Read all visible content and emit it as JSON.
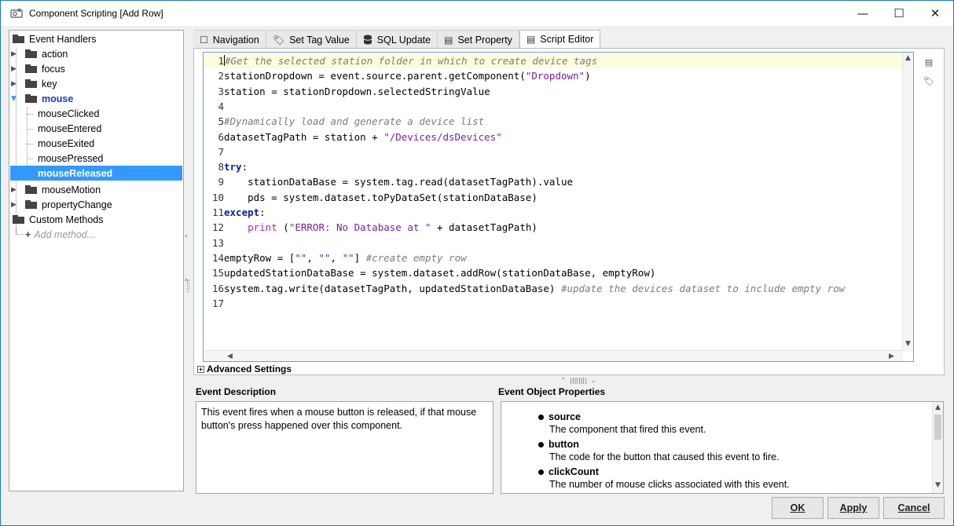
{
  "window": {
    "title": "Component Scripting [Add Row]",
    "controls": [
      "—",
      "☐",
      "✕"
    ]
  },
  "tree": {
    "root_label": "Event Handlers",
    "groups": [
      {
        "label": "action",
        "expanded": false
      },
      {
        "label": "focus",
        "expanded": false
      },
      {
        "label": "key",
        "expanded": false
      },
      {
        "label": "mouse",
        "expanded": true,
        "children": [
          "mouseClicked",
          "mouseEntered",
          "mouseExited",
          "mousePressed",
          "mouseReleased"
        ]
      },
      {
        "label": "mouseMotion",
        "expanded": false
      },
      {
        "label": "propertyChange",
        "expanded": false
      }
    ],
    "selected": "mouseReleased",
    "custom_methods_label": "Custom Methods",
    "add_method_label": "Add method..."
  },
  "tabs": [
    {
      "label": "Navigation",
      "icon": "navigation-icon"
    },
    {
      "label": "Set Tag Value",
      "icon": "tag-icon"
    },
    {
      "label": "SQL Update",
      "icon": "database-icon"
    },
    {
      "label": "Set Property",
      "icon": "property-icon"
    },
    {
      "label": "Script Editor",
      "icon": "script-icon",
      "active": true
    }
  ],
  "editor": {
    "lines": [
      {
        "n": "1",
        "text": "#Get the selected station folder in which to create device tags"
      },
      {
        "n": "2",
        "text": "stationDropdown = event.source.parent.getComponent(\"Dropdown\")"
      },
      {
        "n": "3",
        "text": "station = stationDropdown.selectedStringValue"
      },
      {
        "n": "4",
        "text": ""
      },
      {
        "n": "5",
        "text": "#Dynamically load and generate a device list"
      },
      {
        "n": "6",
        "text": "datasetTagPath = station + \"/Devices/dsDevices\""
      },
      {
        "n": "7",
        "text": ""
      },
      {
        "n": "8",
        "text": "try:"
      },
      {
        "n": "9",
        "text": "    stationDataBase = system.tag.read(datasetTagPath).value"
      },
      {
        "n": "10",
        "text": "    pds = system.dataset.toPyDataSet(stationDataBase)"
      },
      {
        "n": "11",
        "text": "except:"
      },
      {
        "n": "12",
        "text": "    print (\"ERROR: No Database at \" + datasetTagPath)"
      },
      {
        "n": "13",
        "text": ""
      },
      {
        "n": "14",
        "text": "emptyRow = [\"\", \"\", \"\"] #create empty row"
      },
      {
        "n": "15",
        "text": "updatedStationDataBase = system.dataset.addRow(stationDataBase, emptyRow)"
      },
      {
        "n": "16",
        "text": "system.tag.write(datasetTagPath, updatedStationDataBase) #update the devices dataset to include empty row"
      },
      {
        "n": "17",
        "text": ""
      }
    ]
  },
  "advanced_settings_label": "Advanced Settings",
  "event_description": {
    "label": "Event Description",
    "text": "This event fires when a mouse button is released, if that mouse button's press happened over this component."
  },
  "event_object_properties": {
    "label": "Event Object Properties",
    "items": [
      {
        "name": "source",
        "desc": "The component that fired this event."
      },
      {
        "name": "button",
        "desc": "The code for the button that caused this event to fire."
      },
      {
        "name": "clickCount",
        "desc": "The number of mouse clicks associated with this event."
      }
    ]
  },
  "buttons": {
    "ok": "OK",
    "apply": "Apply",
    "cancel": "Cancel"
  }
}
